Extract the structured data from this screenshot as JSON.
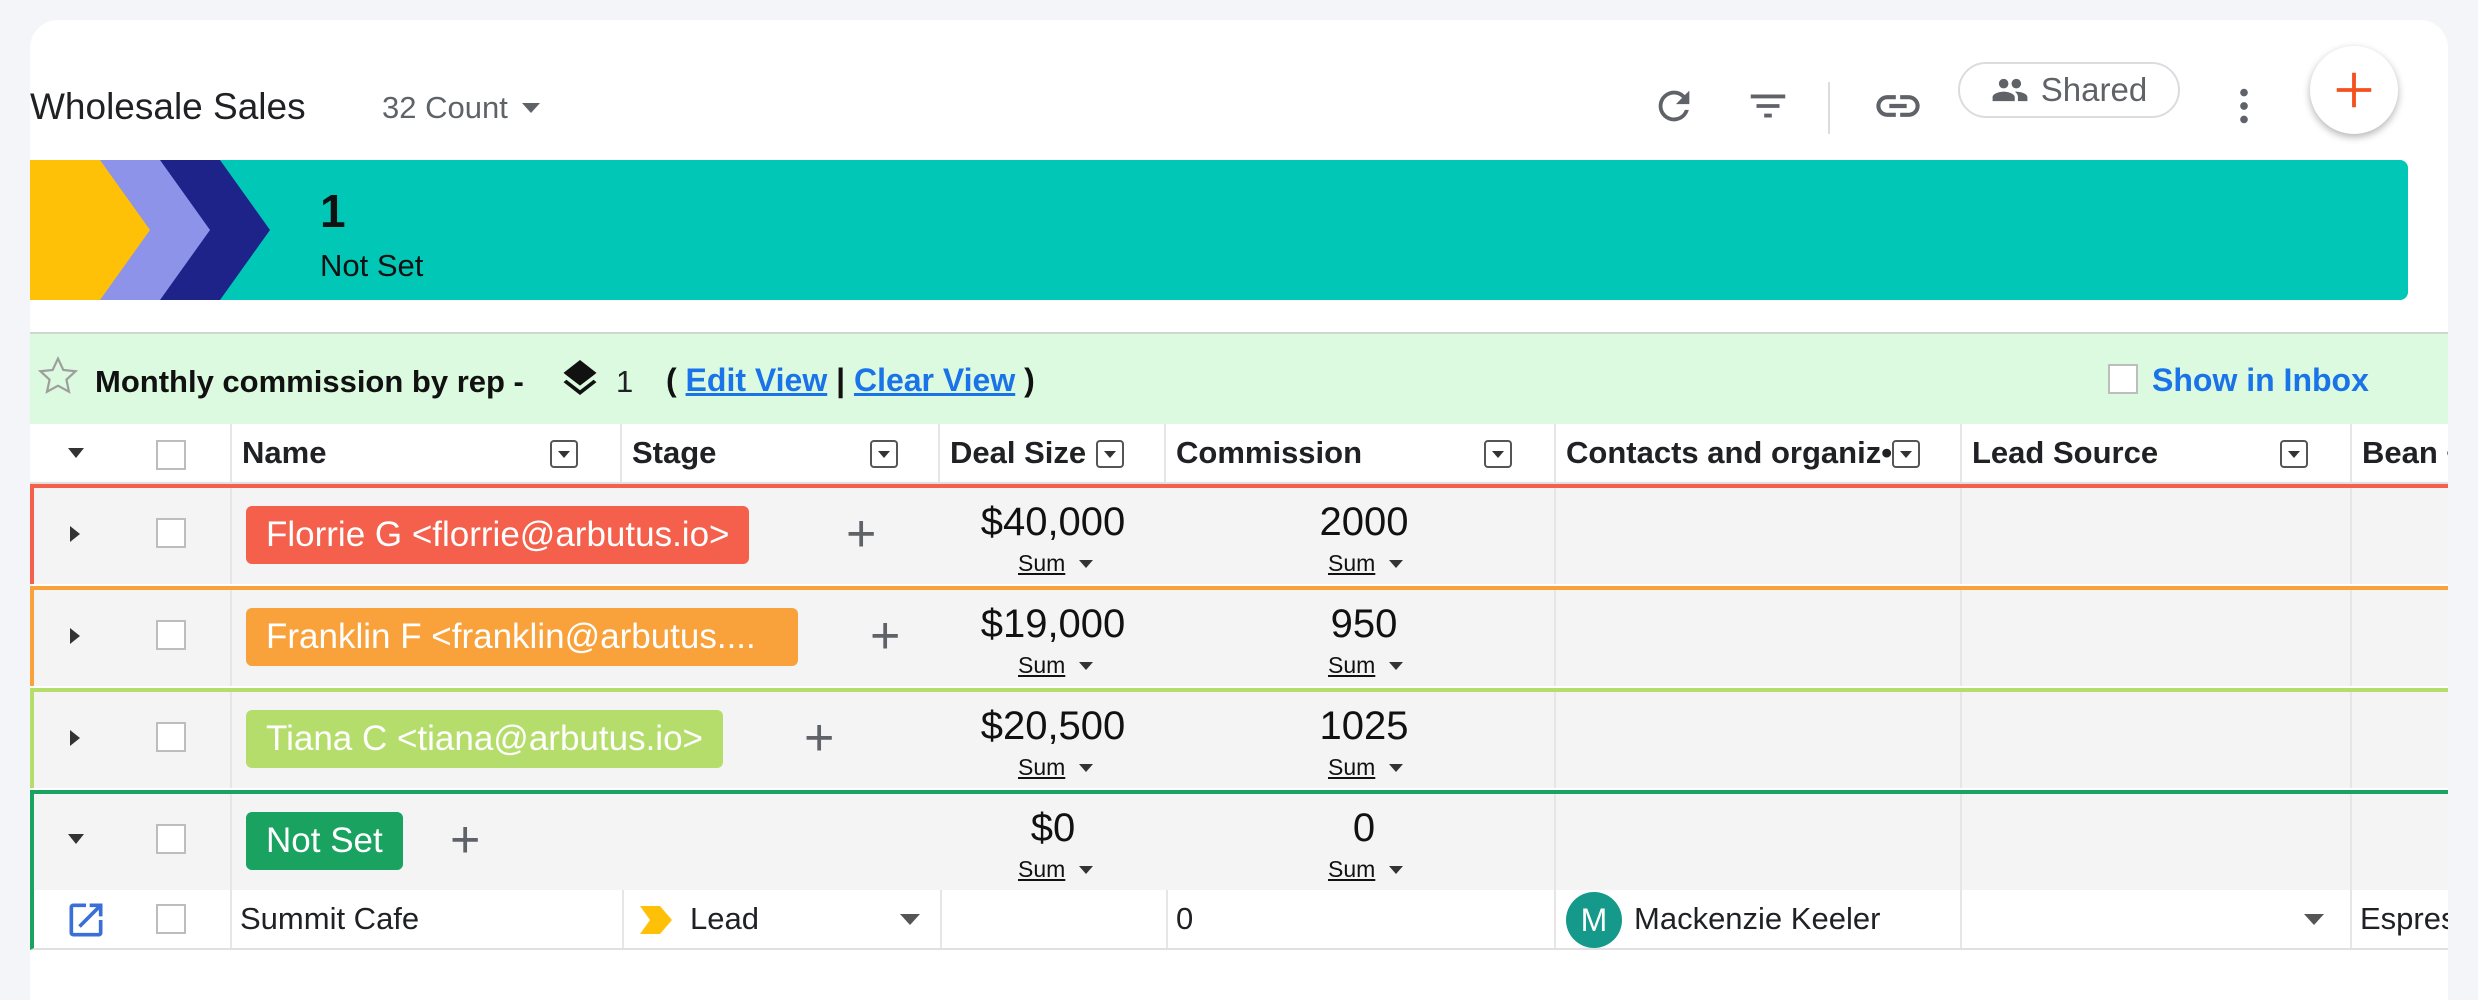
{
  "header": {
    "title": "Wholesale Sales",
    "count_label": "32 Count",
    "shared_label": "Shared"
  },
  "pipeline": {
    "stage_count": "1",
    "stage_label": "Not Set",
    "colors": {
      "teal": "#00c7b6",
      "yellow": "#ffc107",
      "lavender": "#8c93e8",
      "navy": "#1e238a"
    }
  },
  "view": {
    "name": "Monthly commission by rep -",
    "layer_count": "1",
    "open_paren": "(",
    "edit_label": "Edit View",
    "separator": "|",
    "clear_label": "Clear View",
    "close_paren": ")",
    "inbox_label": "Show in Inbox"
  },
  "columns": {
    "name": "Name",
    "stage": "Stage",
    "deal_size": "Deal Size",
    "commission": "Commission",
    "contacts": "Contacts and organiz•io",
    "lead_source": "Lead Source",
    "bean": "Bean •"
  },
  "groups": [
    {
      "label": "Florrie G <florrie@arbutus.io>",
      "color": "#f4604b",
      "deal_size": "$40,000",
      "commission": "2000",
      "sum_label": "Sum"
    },
    {
      "label": "Franklin F <franklin@arbutus....",
      "color": "#f9a23c",
      "deal_size": "$19,000",
      "commission": "950",
      "sum_label": "Sum"
    },
    {
      "label": "Tiana C <tiana@arbutus.io>",
      "color": "#b5dd6b",
      "deal_size": "$20,500",
      "commission": "1025",
      "sum_label": "Sum"
    },
    {
      "label": "Not Set",
      "color": "#1aa260",
      "deal_size": "$0",
      "commission": "0",
      "sum_label": "Sum"
    }
  ],
  "row": {
    "name": "Summit Cafe",
    "stage": "Lead",
    "deal_size": "",
    "commission": "0",
    "contact_initial": "M",
    "contact_name": "Mackenzie Keeler",
    "lead_source": "",
    "bean": "Espres"
  },
  "icons": {
    "refresh": "refresh-icon",
    "filter": "filter-icon",
    "link": "link-icon",
    "people": "people-icon",
    "more": "more-vert-icon",
    "add": "add-icon",
    "star": "star-icon",
    "layers": "layers-icon",
    "open": "open-in-new-icon"
  }
}
